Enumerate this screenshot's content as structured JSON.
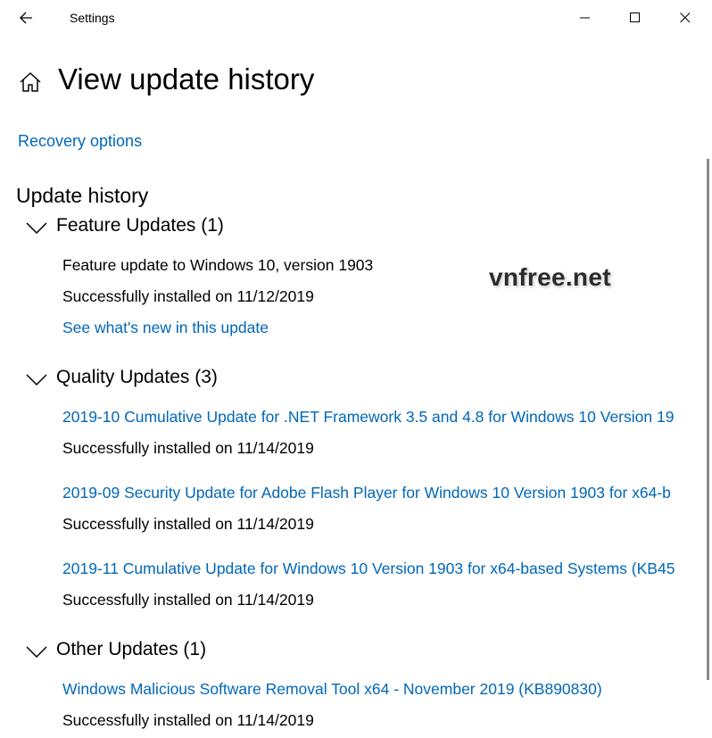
{
  "window": {
    "app_title": "Settings"
  },
  "page": {
    "title": "View update history",
    "recovery_link": "Recovery options",
    "section_heading": "Update history"
  },
  "groups": {
    "feature": {
      "title": "Feature Updates (1)",
      "items": [
        {
          "name": "Feature update to Windows 10, version 1903",
          "status": "Successfully installed on 11/12/2019",
          "link": "See what's new in this update"
        }
      ]
    },
    "quality": {
      "title": "Quality Updates (3)",
      "items": [
        {
          "name": "2019-10 Cumulative Update for .NET Framework 3.5 and 4.8 for Windows 10 Version 19",
          "status": "Successfully installed on 11/14/2019"
        },
        {
          "name": "2019-09 Security Update for Adobe Flash Player for Windows 10 Version 1903 for x64-b",
          "status": "Successfully installed on 11/14/2019"
        },
        {
          "name": "2019-11 Cumulative Update for Windows 10 Version 1903 for x64-based Systems (KB45",
          "status": "Successfully installed on 11/14/2019"
        }
      ]
    },
    "other": {
      "title": "Other Updates (1)",
      "items": [
        {
          "name": "Windows Malicious Software Removal Tool x64 - November 2019 (KB890830)",
          "status": "Successfully installed on 11/14/2019"
        }
      ]
    }
  },
  "watermark": "vnfree.net",
  "icons": {
    "back": "back-arrow-icon",
    "home": "home-icon",
    "minimize": "minimize-icon",
    "maximize": "maximize-icon",
    "close": "close-icon",
    "chevron": "chevron-down-icon"
  },
  "colors": {
    "link": "#0067b8",
    "text": "#000000",
    "background": "#ffffff"
  }
}
